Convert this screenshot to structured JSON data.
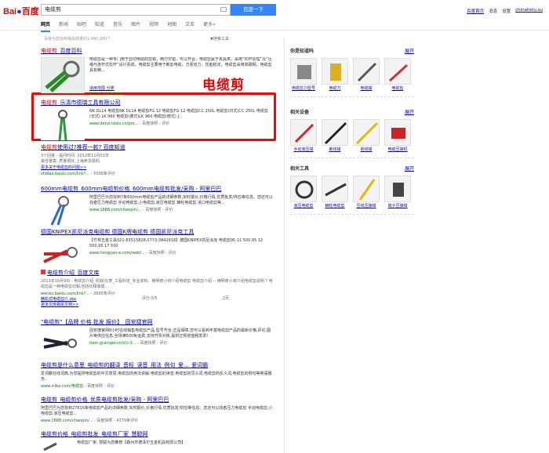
{
  "header": {
    "logo_text": "Bai",
    "logo_paw": "du",
    "logo_cn": "百度",
    "search_value": "电缆剪",
    "search_button": "百度一下",
    "links": [
      "百度首页",
      "消息",
      "设置",
      "chinahelu.su"
    ]
  },
  "tabs": [
    "网页",
    "新闻",
    "贴吧",
    "知道",
    "音乐",
    "图片",
    "视频",
    "地图",
    "文库",
    "更多»"
  ],
  "result_count": "百度为您找到相关结果约1,480,000个",
  "tool_link": "搜索工具",
  "annotation": "电缆剪",
  "results": [
    {
      "title_pre": "电缆剪",
      "title_post": "_百度百科",
      "text": "电缆剪是一种专门用于剪切电缆的剪钳，两刃交错，可以开合，电缆剪属于夹具类，采用“杠杆原理”及“压缩与连杆式杠杆”设计而成，电缆剪主要用于断剪电缆，方便省力，性能稳定，电缆剪采用高碳钢，电缆剪具有精...",
      "sub_links": "适用范围  分类",
      "url": "baike.baidu.com/"
    },
    {
      "title_pre": "电缆剪",
      "title_post": "_乐清市德瑞工具有限公司",
      "text": "NK DL14 电缆剪NK DL14 电缆剪FG 12 电缆剪FG 12 电缆剪CC 250L 电缆剪(日式)CC 250L 电缆剪(日式) LK 960 电缆剪(德式)LK 960 电缆剪(德式) J...",
      "url": "www.derui-tools.cn/pro...",
      "url_sub": "- 百度快照 - 评价"
    },
    {
      "title_pre": "电缆剪",
      "title_post": "使用过?推荐一款? 百度知道",
      "meta1": "3个回答 - 提问时间: 2012年11月01日",
      "meta2": "最佳答案: 质量很好,上海卖货很的.",
      "meta3": "更多关于电缆剪的问题>>",
      "url": "zhidao.baidu.com/link?...",
      "url_sub": "- 5096条评价"
    },
    {
      "title": "600mm电缆剪_600mm电缆剪价格_600mm电缆剪批发/采购 - 阿里巴巴",
      "text": "阿里巴巴为您找到7条600mm电缆剪产品的详细参数,实时报价,价格行情,优质批发/供应等信息。您还可以找者压力电缆剪 手动电缆剪,小电缆剪,液压电缆剪 棘轮电缆剪 进口电缆剪等...",
      "url": "www.1688.com/chanpin/...",
      "url_sub": "- 百度快照 - 评价"
    },
    {
      "title": "德国KNIPEX凯尼派克电缆剪 德国K牌电缆剪 德国凯尼派克工具",
      "text": "【竹林五金工具021-63515828,0773-3842918】德国KNIPEX凯尼派克 电缆剪95.11 500,95 12 500,95 17 500",
      "url": "www.hongyan-e.com/web/...",
      "url_sub": "- 百度快照 - 评价"
    },
    {
      "title": "电缆剪介绍_百度文库",
      "meta1": "2013年10月9日 - 电缆剪介绍_机械/仪表_工程科技_专业资料。精明奇小将介绍电缆剪 电缆剪介绍 -- 精明奇小将介绍电缆剪说明 ? 电缆剪是一种电缆剪切钳,包括切钳装置...",
      "url": "wenku.baidu.com/link?...",
      "url_sub": "- 3695条评价",
      "doc_title": "精松式电缆剪介.doc",
      "doc_rating": "评分:0/5",
      "doc_pages": "2页",
      "doc_more": "更多文库相关文档>>"
    },
    {
      "title": "\"电缆剪\"【品牌 价格 批发 报价】_固安捷官网",
      "text": "固安捷官网8小时在线销售电缆剪产品,型号齐全,正品保障,您可以看到丰富电缆剪产品的最新价格,评论,图片等供应信息,全场满500免运费,支持开票对账,提供正规增值税发票!",
      "url": "item.grainger.cn/s/c-3...",
      "url_sub": "- 百度快照 - 评价"
    },
    {
      "title": "电缆剪是什么意思_电缆剪的翻译_音标_读音_用法_例句_爱..._爱词霸",
      "text": "爱词霸在线词典,为您提供电缆剪的中文意思,电缆剪的用法讲解,电缆剪的读音,电缆剪的同义词,电缆剪的反义词,电缆剪的例句等英语服务。",
      "url": "www.iciba.com/电缆剪",
      "url_sub": "- 百度快照 - 评价"
    },
    {
      "title": "电缆剪_电缆剪价格_优质电缆剪批发/采购 - 阿里巴巴",
      "text": "阿里巴巴为您找到27615条电缆剪产品的详细参数,实时报价,价格行情,优质批发/供应等信息。您还可以找者压力电缆剪 手动电缆剪,小电缆剪,液压电缆剪...",
      "url": "www.1688.com/chanpin/...",
      "url_sub": "- 百度快照 - 4379条评价"
    },
    {
      "title": "电缆剪价格_电缆剪批发_电缆剪厂家_慧聪网",
      "text": "电缆剪厂家: 慧聪为您推荐【森州市德泽尔五金机具有限公司】"
    }
  ],
  "right": {
    "sections": [
      {
        "title": "你是知道吗",
        "more": "展开",
        "items": [
          "电缆剪刀型号",
          "电缆刀",
          "电缆钳",
          "电缆剪"
        ]
      },
      {
        "title": "相关设备",
        "more": "展开",
        "items": [
          "手动液压钳",
          "断线钳",
          "剥线钳",
          "电缆压接机"
        ]
      },
      {
        "title": "相关工具",
        "more": "展开",
        "items": [
          "液压电缆剪",
          "棘轮电缆剪",
          "压线压接钳",
          "端子压接钳"
        ]
      }
    ]
  }
}
